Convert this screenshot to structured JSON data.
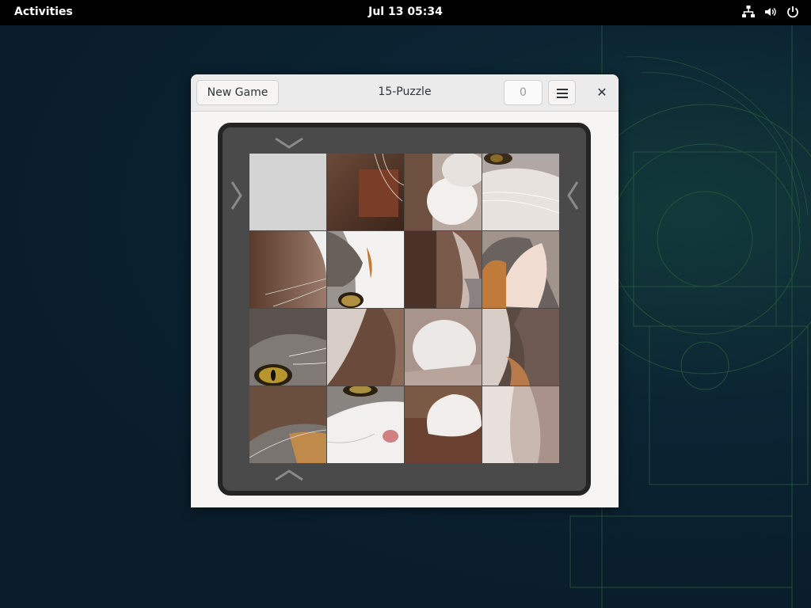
{
  "topbar": {
    "activities": "Activities",
    "clock": "Jul 13  05:34",
    "icons": [
      "network-icon",
      "volume-icon",
      "power-icon"
    ]
  },
  "window": {
    "new_game_label": "New Game",
    "title": "15-Puzzle",
    "move_counter": "0",
    "menu_icon": "hamburger-menu-icon",
    "close_icon": "close-icon"
  },
  "board": {
    "size": 4,
    "blank_position": [
      0,
      0
    ],
    "tiles_description_hint": "cat photo pieces (shuffled)",
    "arrows": [
      "down-arrow-top",
      "up-arrow-bottom",
      "right-arrow-left",
      "left-arrow-right"
    ]
  },
  "colors": {
    "topbar": "#000000",
    "desktop": "#0a1d2b",
    "window_bg": "#f6f5f4",
    "board_frame": "#242424",
    "board_bg": "#4a4a4a",
    "blank_tile": "#d4d4d4"
  }
}
